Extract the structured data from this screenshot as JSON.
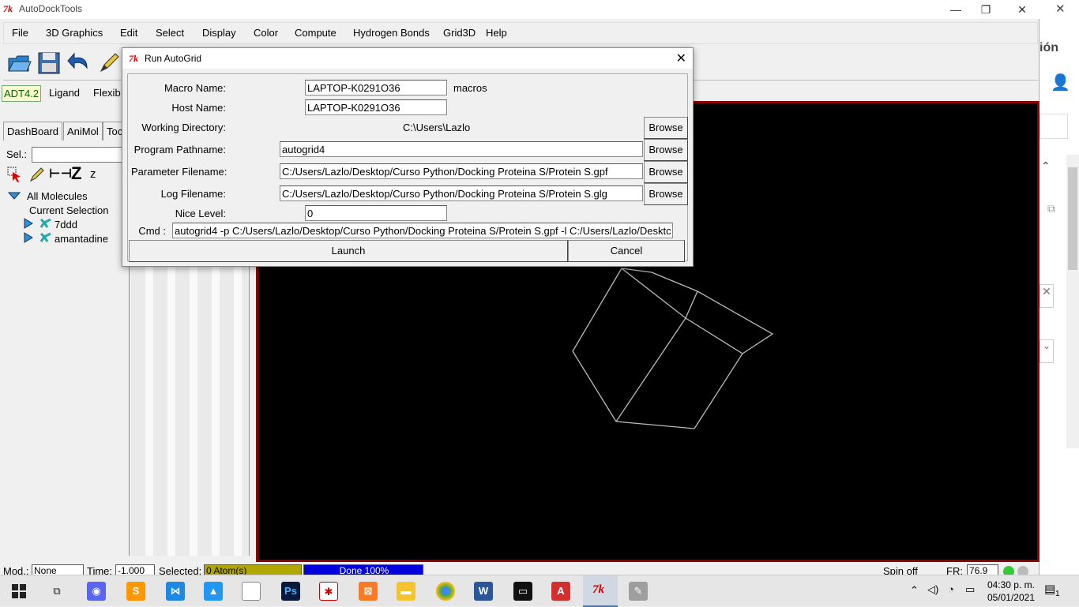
{
  "window": {
    "app_title": "AutoDockTools"
  },
  "menu": [
    "File",
    "3D Graphics",
    "Edit",
    "Select",
    "Display",
    "Color",
    "Compute",
    "Hydrogen Bonds",
    "Grid3D",
    "Help"
  ],
  "adt_tabs": [
    "ADT4.2",
    "Ligand",
    "Flexib"
  ],
  "left_panel": {
    "tabs": [
      "DashBoard",
      "AniMol",
      "Toc"
    ],
    "sel_label": "Sel.:",
    "mini_z_big": "Z",
    "mini_z_small": "z",
    "tree": {
      "root": "All Molecules",
      "current": "Current Selection",
      "molecules": [
        "7ddd",
        "amantadine"
      ]
    }
  },
  "right_app": {
    "text": "ión"
  },
  "dialog": {
    "title": "Run AutoGrid",
    "macro_name_label": "Macro Name:",
    "macro_name_value": "LAPTOP-K0291O36",
    "macros_label": "macros",
    "host_name_label": "Host Name:",
    "host_name_value": "LAPTOP-K0291O36",
    "working_dir_label": "Working Directory:",
    "working_dir_value": "C:\\Users\\Lazlo",
    "program_label": "Program Pathname:",
    "program_value": "autogrid4",
    "parameter_label": "Parameter Filename:",
    "parameter_value": "C:/Users/Lazlo/Desktop/Curso Python/Docking Proteina S/Protein S.gpf",
    "log_label": "Log Filename:",
    "log_value": "C:/Users/Lazlo/Desktop/Curso Python/Docking Proteina S/Protein S.glg",
    "nice_label": "Nice Level:",
    "nice_value": "0",
    "cmd_label": "Cmd :",
    "cmd_value": "autogrid4 -p C:/Users/Lazlo/Desktop/Curso Python/Docking Proteina S/Protein S.gpf -l C:/Users/Lazlo/Desktc",
    "browse_label": "Browse",
    "launch_label": "Launch",
    "cancel_label": "Cancel"
  },
  "status": {
    "mod_label": "Mod.:",
    "mod_value": "None",
    "time_label": "Time:",
    "time_value": "-1.000",
    "selected_label": "Selected:",
    "selected_value": "0 Atom(s)",
    "progress_text": "Done 100%",
    "progress": 1.0,
    "spin_label": "Spin off",
    "fr_label": "FR:",
    "fr_value": "76.9"
  },
  "taskbar": {
    "time": "04:30 p. m.",
    "date": "05/01/2021",
    "notification_count": "1"
  }
}
